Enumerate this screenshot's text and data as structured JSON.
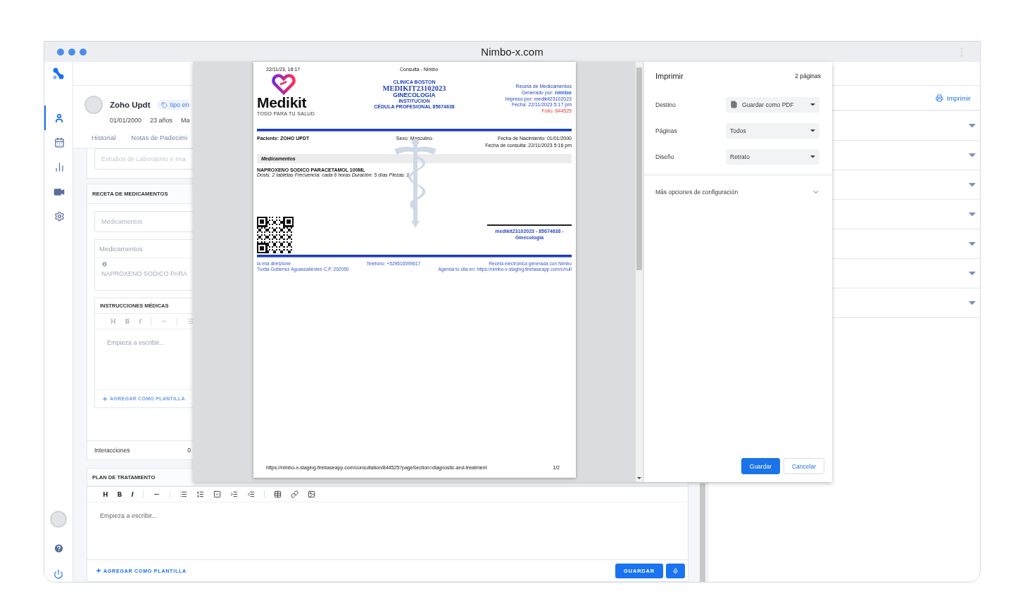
{
  "window": {
    "title": "Nimbo-x.com"
  },
  "sidebar": {
    "items": [
      {
        "kind": "user",
        "selected": true
      },
      {
        "kind": "calendar",
        "selected": false
      },
      {
        "kind": "chart",
        "selected": false
      },
      {
        "kind": "video",
        "selected": false
      },
      {
        "kind": "settings",
        "selected": false
      }
    ]
  },
  "patient": {
    "name": "Zoho Updt",
    "tag": "tipo en",
    "birth_date": "01/01/2000",
    "age": "23 años",
    "column_3": "Ma"
  },
  "tabs": [
    {
      "label": "Historial"
    },
    {
      "label": "Notas de Padecimi"
    }
  ],
  "lab_field": {
    "placeholder": "Estudios de Laboratorio e Ima"
  },
  "prescription": {
    "title": "RECETA DE MEDICAMENTOS",
    "search": {
      "placeholder": "Medicamentos"
    },
    "list_header": "Medicamentos",
    "item": "NAPROXENO SODICO PARA",
    "instructions": {
      "title": "INSTRUCCIONES MÉDICAS",
      "toolbar": [
        "H",
        "B",
        "I"
      ],
      "placeholder": "Empieza a escribir...",
      "template_link": "AGREGAR COMO PLANTILLA"
    },
    "interactions": {
      "label": "Interacciones",
      "count": "0"
    }
  },
  "plan": {
    "title": "PLAN DE TRATAMIENTO",
    "toolbar": [
      "H",
      "B",
      "I"
    ],
    "placeholder": "Empieza a escribir...",
    "template_link": "AGREGAR COMO PLANTILLA",
    "save": "GUARDAR"
  },
  "right_panel": {
    "print_link": "Imprimir",
    "sections": [
      {
        "expanded": false
      },
      {
        "expanded": false
      },
      {
        "expanded": false
      },
      {
        "expanded": false
      },
      {
        "expanded": false
      },
      {
        "expanded": false
      },
      {
        "expanded": false
      }
    ]
  },
  "print_dialog": {
    "title": "Imprimir",
    "page_count": "2 páginas",
    "settings": [
      {
        "label": "Destino",
        "value": "Guardar como PDF",
        "kind": "file"
      },
      {
        "label": "Páginas",
        "value": "Todos",
        "kind": "plain"
      },
      {
        "label": "Diseño",
        "value": "Retrato",
        "kind": "plain"
      }
    ],
    "more_options": {
      "label": "Más opciones de configuración",
      "expanded": false
    },
    "buttons": [
      {
        "label": "Guardar",
        "primary": true
      },
      {
        "label": "Cancelar",
        "primary": false
      }
    ]
  },
  "document": {
    "printed_at": "22/11/23, 18:17",
    "page_title": "Consulta - Nimbo",
    "logo": {
      "name": "Medikit",
      "tagline": "TODO PARA TU SALUD"
    },
    "clinic_lines": [
      {
        "text": "CLINICA BOSTON",
        "kind": "small"
      },
      {
        "text": "MEDIKIT23102023",
        "kind": "serif"
      },
      {
        "text": "GINECOLOGÍA",
        "kind": "large"
      },
      {
        "text": "INSTITUCION",
        "kind": "small"
      },
      {
        "text": "CÉDULA PROFESIONAL 85674638",
        "kind": "small"
      }
    ],
    "info_lines": [
      {
        "text": "Receta de Medicamentos",
        "kind": "title"
      },
      {
        "text": "Generado por:",
        "brand": "nimbo",
        "kind": "brand"
      },
      {
        "text": "Impreso por: medikit23102023",
        "kind": "plain"
      },
      {
        "text": "Fecha: 22/11/2023 5:17 pm",
        "kind": "plain"
      },
      {
        "text": "Folio: 844525",
        "kind": "folio"
      }
    ],
    "patient": "Paciente: ZOHO UPDT",
    "sex": "Sexo: Masculino",
    "birth": "Fecha de Nacimiento: 01/01/2000",
    "consult_date": "Fecha de consulta: 22/11/2023 5:16 pm",
    "section": "Medicamentos",
    "medication": {
      "name": "NAPROXENO SODICO PARACETAMOL 100ML",
      "dose": "Dosis: 2 tabletas Frecuencia: cada 6 horas Duración: 5 días Piezas: 1"
    },
    "signature": [
      "medikit23102023 - 85674638 -",
      "Ginecología"
    ],
    "footer_left": [
      "la mia diretzione",
      "Tuxtla Gutierrez Aguascalientes C.P. 292050"
    ],
    "footer_center": "Telefono: +529616599617",
    "footer_right": [
      "Receta electrónica generada con Nimbo",
      "Agenda tu cita en: https://nimbo-x-staging.firebaseapp.com/c/null"
    ],
    "url": "https://nimbo-x-staging.firebaseapp.com/consultation/844525?pageSection=diagnostic-and-treatment",
    "page_number": "1/2"
  }
}
